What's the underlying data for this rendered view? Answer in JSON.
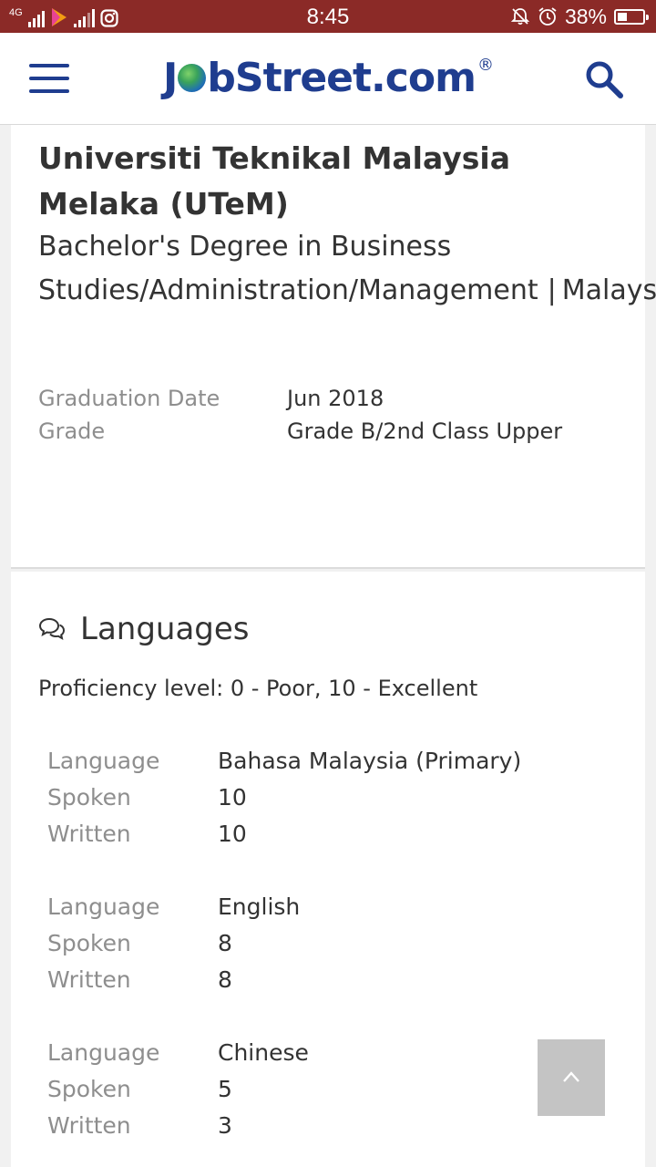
{
  "status_bar": {
    "network_label": "4G",
    "time": "8:45",
    "battery_percent": "38%",
    "battery_level": 0.38,
    "icons": [
      "signal-icon",
      "carrier-icon",
      "signal-icon",
      "instagram-icon",
      "mute-icon",
      "alarm-icon",
      "battery-icon"
    ]
  },
  "header": {
    "logo": {
      "part1": "J",
      "part2": "bStreet.com",
      "registered": "®"
    },
    "icons": [
      "menu-icon",
      "search-icon"
    ],
    "brand_color": "#1f3d8f"
  },
  "education": {
    "school": "Universiti Teknikal Malaysia Melaka (UTeM)",
    "degree": "Bachelor's Degree in Business Studies/Administration/Management",
    "separator": "|",
    "country": "Malaysia",
    "details": [
      {
        "label": "Graduation Date",
        "value": "Jun 2018"
      },
      {
        "label": "Grade",
        "value": "Grade B/2nd Class Upper"
      }
    ]
  },
  "languages": {
    "heading": "Languages",
    "heading_icon": "chat-bubbles-icon",
    "proficiency_note": "Proficiency level: 0 - Poor, 10 - Excellent",
    "labels": {
      "language": "Language",
      "spoken": "Spoken",
      "written": "Written"
    },
    "items": [
      {
        "language": "Bahasa Malaysia (Primary)",
        "spoken": "10",
        "written": "10"
      },
      {
        "language": "English",
        "spoken": "8",
        "written": "8"
      },
      {
        "language": "Chinese",
        "spoken": "5",
        "written": "3"
      }
    ]
  },
  "back_to_top": {
    "icon": "chevron-up-icon"
  },
  "colors": {
    "status_bar": "#8b2a27",
    "label_gray": "#8e8e8e",
    "text": "#333333",
    "background": "#f1f1f1"
  }
}
